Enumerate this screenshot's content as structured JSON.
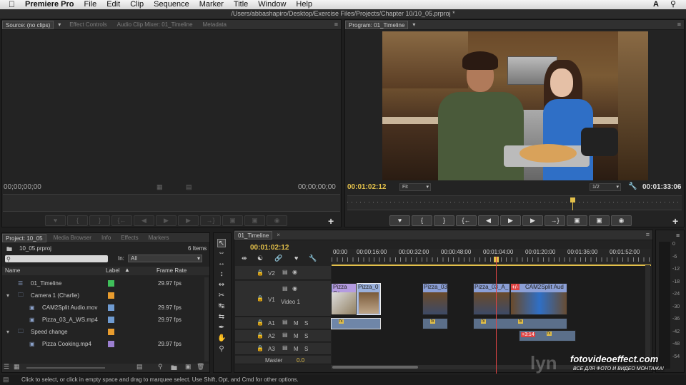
{
  "menubar": {
    "app": "Premiere Pro",
    "items": [
      "File",
      "Edit",
      "Clip",
      "Sequence",
      "Marker",
      "Title",
      "Window",
      "Help"
    ]
  },
  "window_title": "/Users/abbashapiro/Desktop/Exercise Files/Projects/Chapter 10/10_05.prproj *",
  "source_panel": {
    "tabs": [
      "Source: (no clips)",
      "Effect Controls",
      "Audio Clip Mixer: 01_Timeline",
      "Metadata"
    ],
    "tc_left": "00;00;00;00",
    "tc_right": "00;00;00;00"
  },
  "program_panel": {
    "tab": "Program: 01_Timeline",
    "tc_current": "00:01:02:12",
    "fit": "Fit",
    "resolution": "1/2",
    "tc_duration": "00:01:33:06"
  },
  "project_panel": {
    "tabs": [
      "Project: 10_05",
      "Media Browser",
      "Info",
      "Effects",
      "Markers"
    ],
    "file": "10_05.prproj",
    "items_count": "6 Items",
    "in_label": "In:",
    "in_value": "All",
    "columns": {
      "name": "Name",
      "label": "Label",
      "frame_rate": "Frame Rate"
    },
    "rows": [
      {
        "name": "01_Timeline",
        "fps": "29.97 fps",
        "color": "#3fbf5a"
      },
      {
        "name": "Camera 1 (Charlie)",
        "fps": "",
        "color": "#e89c2e"
      },
      {
        "name": "CAM2Split Audio.mov",
        "fps": "29.97 fps",
        "color": "#6f9bd1"
      },
      {
        "name": "Pizza_03_A_WS.mp4",
        "fps": "29.97 fps",
        "color": "#6f9bd1"
      },
      {
        "name": "Speed change",
        "fps": "",
        "color": "#e89c2e"
      },
      {
        "name": "Pizza Cooking.mp4",
        "fps": "29.97 fps",
        "color": "#9b7fd0"
      }
    ]
  },
  "timeline": {
    "tab": "01_Timeline",
    "tc": "00:01:02:12",
    "ruler": [
      "00:00",
      "00:00:16:00",
      "00:00:32:00",
      "00:00:48:00",
      "00:01:04:00",
      "00:01:20:00",
      "00:01:36:00",
      "00:01:52:00"
    ],
    "tracks": {
      "v2": "V2",
      "v1": "V1",
      "v1_name": "Video 1",
      "a1": "A1",
      "a2": "A2",
      "a3": "A3",
      "master": "Master",
      "master_val": "0.0"
    },
    "clips": {
      "c1": "Pizza Co",
      "c2": "Pizza_0",
      "c3": "Pizza_03",
      "c4": "Pizza_03_A_",
      "c5": "CAM2Split Aud",
      "badge_v": "+/-",
      "badge_a": "+3:14"
    }
  },
  "meter_scale": [
    "0",
    "-6",
    "-12",
    "-18",
    "-24",
    "-30",
    "-36",
    "-42",
    "-48",
    "-54"
  ],
  "status": "Click to select, or click in empty space and drag to marquee select. Use Shift, Opt, and Cmd for other options.",
  "watermark": {
    "main": "fotovideoeffect.com",
    "sub": "ВСЕ ДЛЯ ФОТО И ВИДЕО МОНТАЖА!"
  },
  "colors": {
    "accent": "#e3c04a",
    "playhead": "#e04444",
    "video_clip": "#8b9fd6",
    "audio_clip": "#6f86a8"
  }
}
